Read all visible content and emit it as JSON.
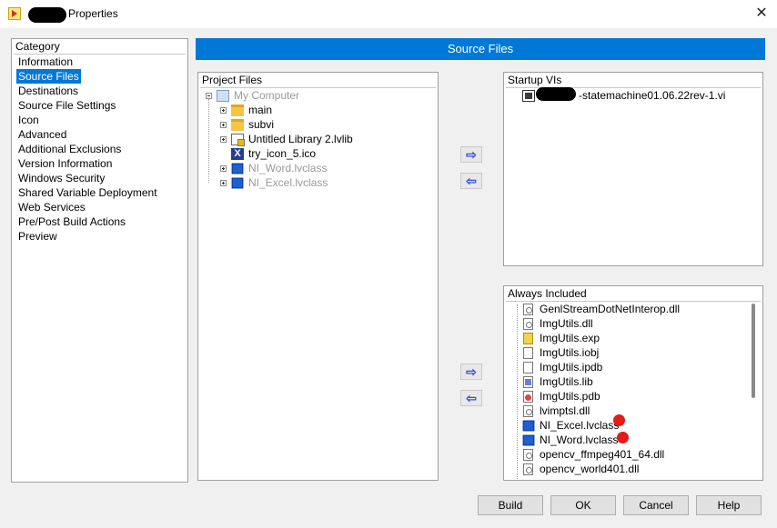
{
  "window": {
    "title": "Properties",
    "close_glyph": "✕"
  },
  "category": {
    "header": "Category",
    "items": [
      "Information",
      "Source Files",
      "Destinations",
      "Source File Settings",
      "Icon",
      "Advanced",
      "Additional Exclusions",
      "Version Information",
      "Windows Security",
      "Shared Variable Deployment",
      "Web Services",
      "Pre/Post Build Actions",
      "Preview"
    ],
    "selected": "Source Files"
  },
  "banner": "Source Files",
  "project_files": {
    "header": "Project Files",
    "items": [
      {
        "label": "My Computer",
        "icon": "computer-icon"
      },
      {
        "label": "main",
        "icon": "folder-icon"
      },
      {
        "label": "subvi",
        "icon": "folder-icon"
      },
      {
        "label": "Untitled Library 2.lvlib",
        "icon": "library-icon"
      },
      {
        "label": "try_icon_5.ico",
        "icon": "ico-file-icon"
      },
      {
        "label": "NI_Word.lvclass",
        "icon": "class-cube-icon"
      },
      {
        "label": "NI_Excel.lvclass",
        "icon": "class-cube-icon"
      }
    ]
  },
  "startup_vis": {
    "header": "Startup VIs",
    "items": [
      "-statemachine01.06.22rev-1.vi"
    ]
  },
  "always_included": {
    "header": "Always Included",
    "items": [
      "GenlStreamDotNetInterop.dll",
      "ImgUtils.dll",
      "ImgUtils.exp",
      "ImgUtils.iobj",
      "ImgUtils.ipdb",
      "ImgUtils.lib",
      "ImgUtils.pdb",
      "lvimptsl.dll",
      "NI_Excel.lvclass",
      "NI_Word.lvclass",
      "opencv_ffmpeg401_64.dll",
      "opencv_world401.dll"
    ]
  },
  "arrows": {
    "right": "⇨",
    "left": "⇦"
  },
  "buttons": {
    "build": "Build",
    "ok": "OK",
    "cancel": "Cancel",
    "help": "Help"
  },
  "colors": {
    "accent": "#0078d7",
    "marker_red": "#e51a1a"
  }
}
